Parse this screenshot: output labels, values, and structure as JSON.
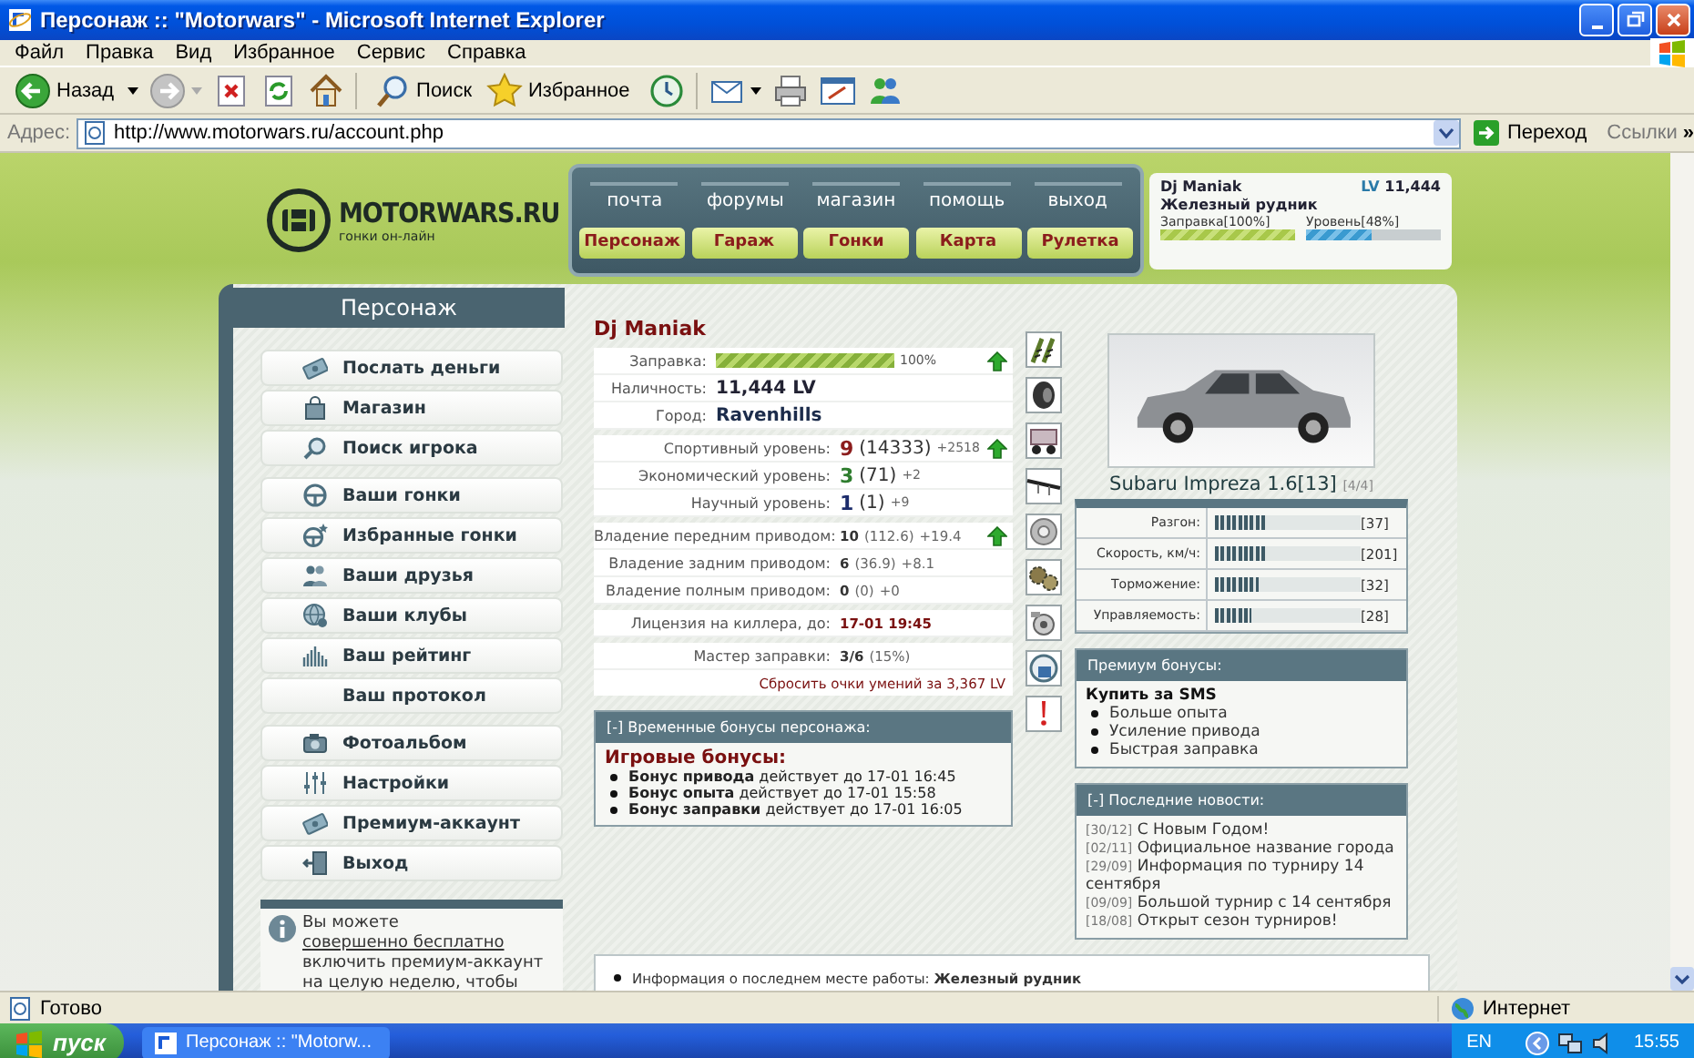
{
  "browser": {
    "title": "Персонаж :: \"Motorwars\" - Microsoft Internet Explorer",
    "menu": [
      "Файл",
      "Правка",
      "Вид",
      "Избранное",
      "Сервис",
      "Справка"
    ],
    "toolbar": {
      "back": "Назад",
      "search": "Поиск",
      "favorites": "Избранное"
    },
    "address": {
      "label": "Адрес:",
      "url": "http://www.motorwars.ru/account.php",
      "go": "Переход",
      "links": "Ссылки",
      "more": "»"
    }
  },
  "site": {
    "logo": {
      "name": "MOTORWARS.RU",
      "tagline": "гонки он-лайн"
    },
    "top_nav": [
      "почта",
      "форумы",
      "магазин",
      "помощь",
      "выход"
    ],
    "main_nav": [
      "Персонаж",
      "Гараж",
      "Гонки",
      "Карта",
      "Рулетка"
    ],
    "user": {
      "name": "Dj Maniak",
      "currency": "LV",
      "cash": "11,444",
      "location": "Железный рудник",
      "fuel": {
        "label": "Заправка[100%]",
        "level": 1
      },
      "experience": {
        "label": "Уровень[48%]",
        "level": 0.48
      }
    },
    "sidebar": {
      "title": "Персонаж",
      "groups": [
        [
          {
            "label": "Послать деньги"
          },
          {
            "label": "Магазин"
          },
          {
            "label": "Поиск игрока"
          }
        ],
        [
          {
            "label": "Ваши гонки"
          },
          {
            "label": "Избранные гонки"
          },
          {
            "label": "Ваши друзья"
          },
          {
            "label": "Ваши клубы"
          },
          {
            "label": "Ваш рейтинг"
          },
          {
            "label": "Ваш протокол"
          }
        ],
        [
          {
            "label": "Фотоальбом"
          },
          {
            "label": "Настройки"
          },
          {
            "label": "Премиум-аккаунт"
          },
          {
            "label": "Выход"
          }
        ]
      ],
      "notice": {
        "before": "Вы можете ",
        "link": "совершенно бесплатно",
        "after": " включить премиум-аккаунт на целую неделю, чтобы"
      }
    },
    "character": {
      "name": "Dj Maniak",
      "groups": [
        [
          {
            "kind": "meter",
            "label": "Заправка:",
            "level": 1,
            "reading": "100%",
            "upgrade": true
          },
          {
            "kind": "amount",
            "label": "Наличность:",
            "value": "11,444 LV",
            "upgrade": false
          },
          {
            "kind": "place",
            "label": "Город:",
            "value": "Ravenhills",
            "upgrade": false
          }
        ],
        [
          {
            "kind": "level",
            "label": "Спортивный уровень:",
            "value": "9",
            "points": "(14333)",
            "gain": "+2518",
            "color": "#8b1c1c",
            "upgrade": true
          },
          {
            "kind": "level",
            "label": "Экономический уровень:",
            "value": "3",
            "points": "(71)",
            "gain": "+2",
            "color": "#2e7d2e",
            "upgrade": false
          },
          {
            "kind": "level",
            "label": "Научный уровень:",
            "value": "1",
            "points": "(1)",
            "gain": "+9",
            "color": "#1c2c6b",
            "upgrade": false
          }
        ],
        [
          {
            "kind": "skill",
            "label": "Владение передним приводом:",
            "value": "10",
            "points": "(112.6)",
            "gain": "+19.4",
            "upgrade": true
          },
          {
            "kind": "skill",
            "label": "Владение задним приводом:",
            "value": "6",
            "points": "(36.9)",
            "gain": "+8.1",
            "upgrade": false
          },
          {
            "kind": "skill",
            "label": "Владение полным приводом:",
            "value": "0",
            "points": "(0)",
            "gain": "+0",
            "upgrade": false
          }
        ],
        [
          {
            "kind": "date",
            "label": "Лицензия на киллера, до:",
            "value": "17-01 19:45",
            "upgrade": false
          }
        ],
        [
          {
            "kind": "skill",
            "label": "Мастер заправки:",
            "value": "3/6",
            "points": "(15%)",
            "upgrade": false
          }
        ]
      ],
      "reset_link": "Сбросить очки умений за 3,367 LV"
    },
    "bonuses": {
      "title": "[-] Временные бонусы персонажа:",
      "heading": "Игровые бонусы:",
      "items": [
        "**Бонус привода** действует до 17-01 16:45",
        "**Бонус опыта** действует до 17-01 15:58",
        "**Бонус заправки** действует до 17-01 16:05"
      ]
    },
    "car": {
      "name": "Subaru Impreza 1.6[13]",
      "slots": "[4/4]",
      "stats": [
        {
          "label": "Разгон:",
          "level": 0.35,
          "reading": "[37]"
        },
        {
          "label": "Скорость, км/ч:",
          "level": 0.35,
          "reading": "[201]"
        },
        {
          "label": "Торможение:",
          "level": 0.3,
          "reading": "[32]"
        },
        {
          "label": "Управляемость:",
          "level": 0.25,
          "reading": "[28]"
        }
      ]
    },
    "premium": {
      "title": "Премиум бонусы:",
      "heading": "Купить за SMS",
      "items": [
        "Больше опыта",
        "Усиление привода",
        "Быстрая заправка"
      ]
    },
    "news": {
      "title": "[-] Последние новости:",
      "items": [
        {
          "date": "[30/12]",
          "text": "С Новым Годом!"
        },
        {
          "date": "[02/11]",
          "text": "Официальное название города"
        },
        {
          "date": "[29/09]",
          "text": "Информация по турниру 14 сентября"
        },
        {
          "date": "[09/09]",
          "text": "Большой турнир с 14 сентября"
        },
        {
          "date": "[18/08]",
          "text": "Открыт сезон турниров!"
        }
      ]
    },
    "last_job": "Информация о последнем месте работы: **Железный рудник**"
  },
  "status_bar": {
    "text": "Готово",
    "zone": "Интернет"
  },
  "taskbar": {
    "start": "пуск",
    "task": "Персонаж :: \"Motorw...",
    "language": "EN",
    "time": "15:55"
  }
}
